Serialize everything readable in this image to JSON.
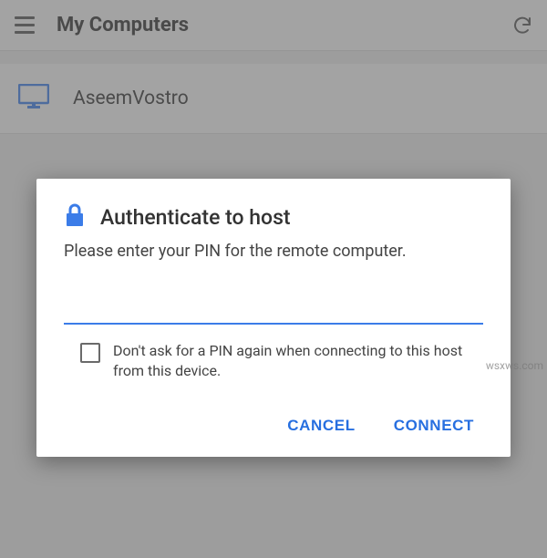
{
  "header": {
    "title": "My Computers"
  },
  "list": {
    "items": [
      {
        "name": "AseemVostro"
      }
    ]
  },
  "dialog": {
    "title": "Authenticate to host",
    "body": "Please enter your PIN for the remote computer.",
    "pin_value": "",
    "remember_label": "Don't ask for a PIN again when connecting to this host from this device.",
    "cancel_label": "CANCEL",
    "connect_label": "CONNECT"
  },
  "watermark": "wsxws.com",
  "colors": {
    "accent": "#3b7ce8",
    "primary_text": "#333333"
  }
}
